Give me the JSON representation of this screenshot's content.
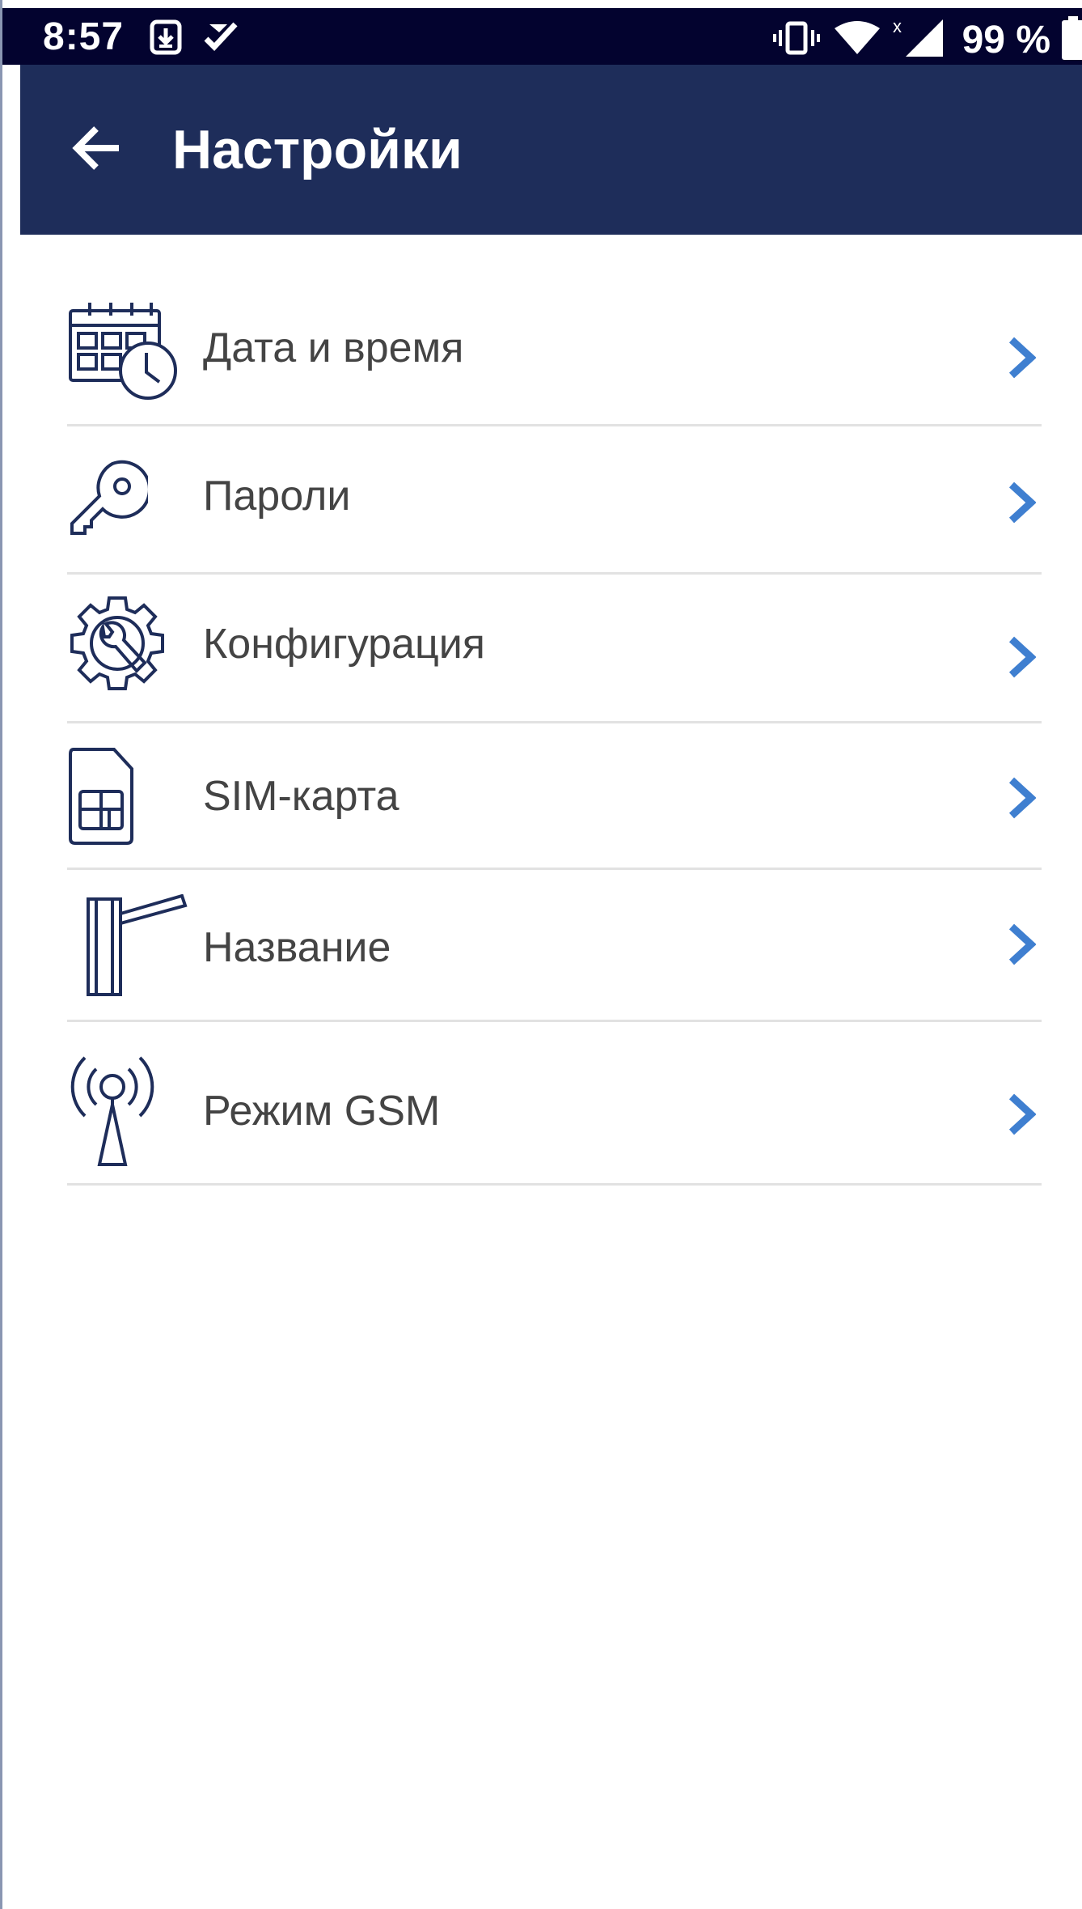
{
  "status_bar": {
    "time": "8:57",
    "left_icons": [
      "download-notification-icon",
      "task-check-icon"
    ],
    "right_icons": [
      "vibrate-icon",
      "wifi-icon",
      "cell-signal-icon",
      "battery-icon"
    ],
    "battery_text": "99 %"
  },
  "app_bar": {
    "back_icon": "arrow-left-icon",
    "title": "Настройки"
  },
  "settings": {
    "items": [
      {
        "id": "date-time",
        "label": "Дата и время",
        "icon": "calendar-clock-icon"
      },
      {
        "id": "passwords",
        "label": "Пароли",
        "icon": "key-icon"
      },
      {
        "id": "configuration",
        "label": "Конфигурация",
        "icon": "gear-wrench-icon"
      },
      {
        "id": "sim-card",
        "label": "SIM-карта",
        "icon": "sim-card-icon"
      },
      {
        "id": "name",
        "label": "Название",
        "icon": "barrier-gate-icon"
      },
      {
        "id": "gsm-mode",
        "label": "Режим GSM",
        "icon": "antenna-icon"
      }
    ],
    "chevron_icon": "chevron-right-icon"
  },
  "colors": {
    "status_bar_bg": "#03032f",
    "app_bar_bg": "#1e2d5a",
    "icon_stroke": "#1e2d5a",
    "chevron": "#3f7fd0",
    "label_text": "#444444",
    "divider": "#e2e2e2"
  }
}
